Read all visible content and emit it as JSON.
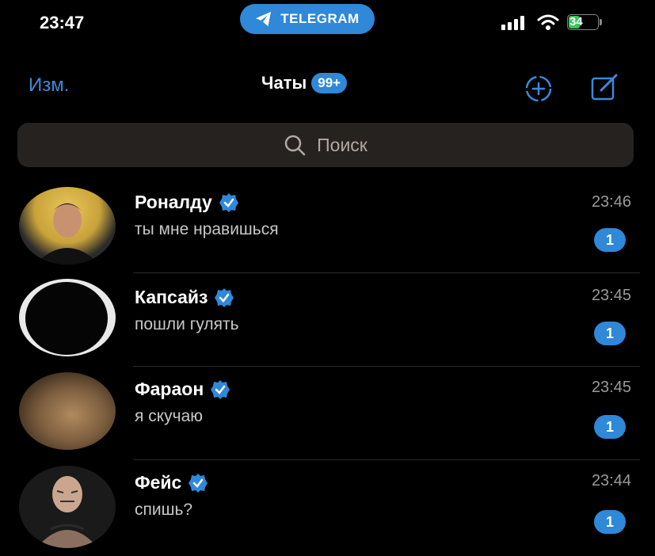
{
  "status": {
    "time": "23:47",
    "app_pill": "TELEGRAM",
    "battery": "34"
  },
  "nav": {
    "edit": "Изм.",
    "title": "Чаты",
    "badge": "99+"
  },
  "search": {
    "placeholder": "Поиск"
  },
  "chats": [
    {
      "name": "Роналду",
      "preview": "ты мне нравишься",
      "time": "23:46",
      "unread": "1",
      "verified": true
    },
    {
      "name": "Капсайз",
      "preview": "пошли гулять",
      "time": "23:45",
      "unread": "1",
      "verified": true
    },
    {
      "name": "Фараон",
      "preview": "я скучаю",
      "time": "23:45",
      "unread": "1",
      "verified": true
    },
    {
      "name": "Фейс",
      "preview": "спишь?",
      "time": "23:44",
      "unread": "1",
      "verified": true
    }
  ],
  "colors": {
    "accent": "#2f88d8",
    "background": "#000000",
    "search_bg": "#26221f"
  },
  "icons": [
    "telegram-plane-icon",
    "signal-icon",
    "wifi-icon",
    "battery-icon",
    "story-add-icon",
    "compose-icon",
    "search-icon",
    "verified-icon"
  ]
}
